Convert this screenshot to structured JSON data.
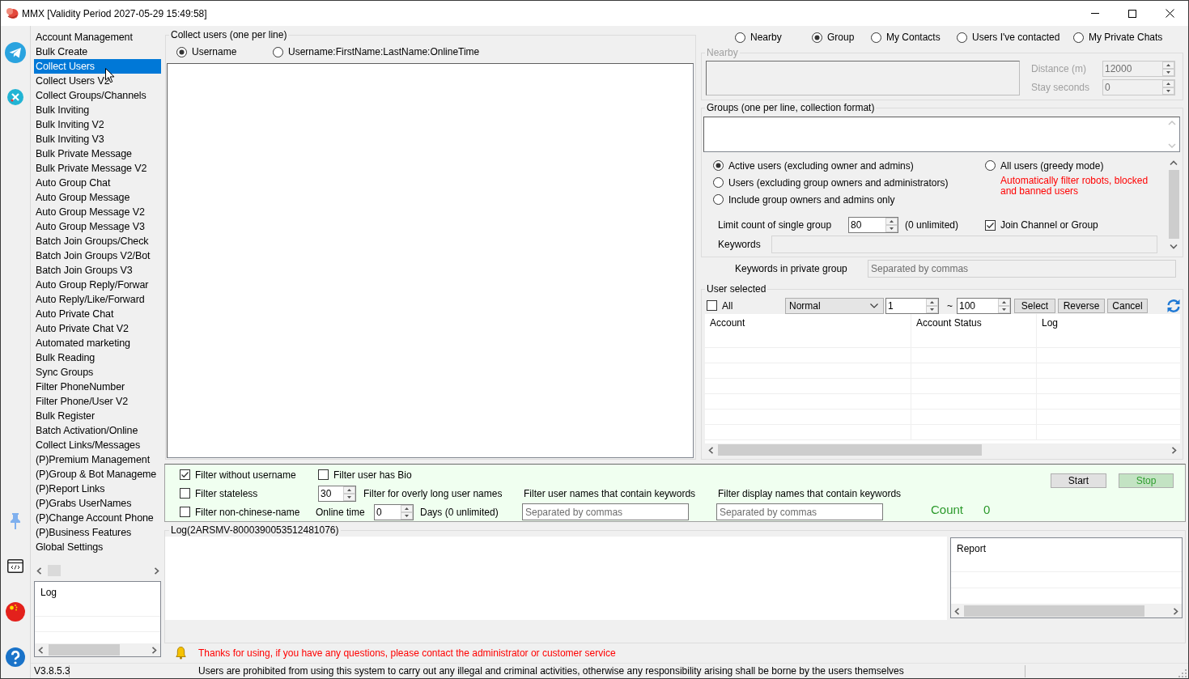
{
  "window": {
    "title": "MMX [Validity Period 2027-05-29 15:49:58]"
  },
  "sidebar": {
    "items": [
      {
        "label": "Account Management",
        "selected": false
      },
      {
        "label": "Bulk Create",
        "selected": false
      },
      {
        "label": "Collect Users",
        "selected": true
      },
      {
        "label": "Collect Users V2",
        "selected": false
      },
      {
        "label": "Collect Groups/Channels",
        "selected": false
      },
      {
        "label": "Bulk Inviting",
        "selected": false
      },
      {
        "label": "Bulk Inviting V2",
        "selected": false
      },
      {
        "label": "Bulk Inviting V3",
        "selected": false
      },
      {
        "label": "Bulk Private Message",
        "selected": false
      },
      {
        "label": "Bulk Private Message V2",
        "selected": false
      },
      {
        "label": "Auto Group Chat",
        "selected": false
      },
      {
        "label": "Auto Group Message",
        "selected": false
      },
      {
        "label": "Auto Group Message V2",
        "selected": false
      },
      {
        "label": "Auto Group Message V3",
        "selected": false
      },
      {
        "label": "Batch Join Groups/Check",
        "selected": false
      },
      {
        "label": "Batch Join Groups V2/Bot",
        "selected": false
      },
      {
        "label": "Batch Join Groups V3",
        "selected": false
      },
      {
        "label": "Auto Group Reply/Forwar",
        "selected": false
      },
      {
        "label": "Auto Reply/Like/Forward",
        "selected": false
      },
      {
        "label": "Auto Private Chat",
        "selected": false
      },
      {
        "label": "Auto Private Chat V2",
        "selected": false
      },
      {
        "label": "Automated marketing",
        "selected": false
      },
      {
        "label": "Bulk Reading",
        "selected": false
      },
      {
        "label": "Sync Groups",
        "selected": false
      },
      {
        "label": "Filter PhoneNumber",
        "selected": false
      },
      {
        "label": "Filter Phone/User V2",
        "selected": false
      },
      {
        "label": "Bulk Register",
        "selected": false
      },
      {
        "label": "Batch Activation/Online",
        "selected": false
      },
      {
        "label": "Collect Links/Messages",
        "selected": false
      },
      {
        "label": "(P)Premium Management",
        "selected": false
      },
      {
        "label": "(P)Group & Bot Manageme",
        "selected": false
      },
      {
        "label": "(P)Report Links",
        "selected": false
      },
      {
        "label": "(P)Grabs UserNames",
        "selected": false
      },
      {
        "label": "(P)Change Account Phone",
        "selected": false
      },
      {
        "label": "(P)Business Features",
        "selected": false
      },
      {
        "label": "Global Settings",
        "selected": false
      }
    ],
    "log_header": "Log"
  },
  "collect_users": {
    "title": "Collect users (one per line)",
    "formats": [
      {
        "label": "Username",
        "selected": true
      },
      {
        "label": "Username:FirstName:LastName:OnlineTime",
        "selected": false
      }
    ]
  },
  "sources": [
    {
      "label": "Nearby",
      "selected": false
    },
    {
      "label": "Group",
      "selected": true
    },
    {
      "label": "My Contacts",
      "selected": false
    },
    {
      "label": "Users I've contacted",
      "selected": false
    },
    {
      "label": "My Private Chats",
      "selected": false
    }
  ],
  "nearby": {
    "title": "Nearby",
    "disabled": true,
    "fields": [
      {
        "label": "Distance (m)",
        "value": "12000"
      },
      {
        "label": "Stay seconds",
        "value": "0"
      }
    ]
  },
  "groups": {
    "title": "Groups (one per line, collection format)",
    "user_types": [
      {
        "label": "Active users (excluding owner and admins)",
        "selected": true
      },
      {
        "label": "Users (excluding group owners and administrators)",
        "selected": false
      },
      {
        "label": "Include group owners and admins only",
        "selected": false
      }
    ],
    "greedy": {
      "label": "All users (greedy mode)",
      "selected": false,
      "note": "Automatically filter robots, blocked and banned users"
    },
    "limit": {
      "label": "Limit count of single group",
      "value": "80",
      "hint": "(0 unlimited)"
    },
    "join": {
      "label": "Join Channel or Group",
      "checked": true
    },
    "keywords": {
      "label": "Keywords"
    }
  },
  "private_keywords": {
    "label": "Keywords in private group",
    "placeholder": "Separated by commas"
  },
  "user_selected": {
    "title": "User selected",
    "all": {
      "label": "All",
      "checked": false
    },
    "mode": "Normal",
    "range_from": "1",
    "range_sep": "~",
    "range_to": "100",
    "buttons": [
      "Select",
      "Reverse",
      "Cancel"
    ],
    "columns": [
      "Account",
      "Account Status",
      "Log"
    ]
  },
  "filters": {
    "checks": [
      {
        "label": "Filter without username",
        "checked": true
      },
      {
        "label": "Filter user has Bio",
        "checked": false
      },
      {
        "label": "Filter stateless",
        "checked": false
      },
      {
        "label": "Filter non-chinese-name",
        "checked": false
      }
    ],
    "long_name": {
      "value": "30",
      "label": "Filter for overly long user names"
    },
    "online": {
      "label": "Online time",
      "value": "0",
      "unit": "Days (0 unlimited)"
    },
    "keyword_filters": [
      {
        "label": "Filter user names that contain keywords",
        "placeholder": "Separated by commas"
      },
      {
        "label": "Filter display names that contain keywords",
        "placeholder": "Separated by commas"
      }
    ],
    "count": {
      "label": "Count",
      "value": "0"
    },
    "buttons": [
      {
        "label": "Start",
        "kind": "start"
      },
      {
        "label": "Stop",
        "kind": "stop"
      }
    ]
  },
  "log": {
    "title": "Log(2ARSMV-8000390053512481076)",
    "report_header": "Report"
  },
  "notice": "Thanks for using, if you have any questions, please contact the administrator or customer service",
  "status_bar": {
    "version": "V3.8.5.3",
    "message": "Users are prohibited from using this system to carry out any illegal and criminal activities, otherwise any responsibility arising shall be borne by the users themselves"
  }
}
